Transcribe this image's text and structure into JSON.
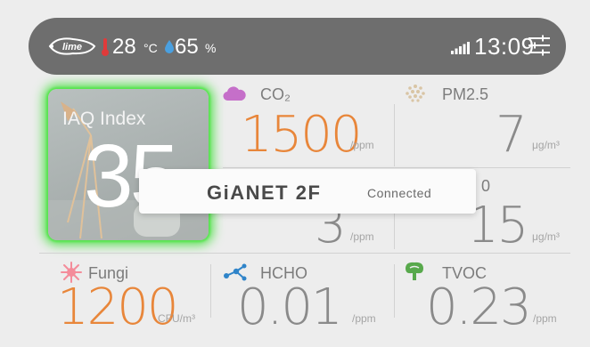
{
  "status_bar": {
    "logo_text": "lime",
    "temperature": "28",
    "temperature_unit": "°C",
    "humidity": "65",
    "humidity_unit": "%",
    "time": "13:09",
    "icons": [
      "lime-logo-icon",
      "thermometer-icon",
      "water-drop-icon",
      "signal-bars-icon",
      "settings-sliders-icon"
    ]
  },
  "iaq": {
    "label": "IAQ Index",
    "value": "35",
    "glow_color": "#53e04c"
  },
  "metrics": {
    "co2": {
      "label": "CO₂",
      "value": "1500",
      "unit": "/ppm",
      "value_color": "#e8863a",
      "icon": "cloud-icon",
      "icon_color": "#c56fc9"
    },
    "pm25": {
      "label": "PM2.5",
      "value": "7",
      "unit": "μg/m³",
      "value_color": "#8a8a8a",
      "icon": "particles-icon",
      "icon_color": "#d9c5a5"
    },
    "mid_left": {
      "value": "3",
      "unit": "/ppm",
      "value_color": "#8a8a8a"
    },
    "mid_right": {
      "label": "0",
      "value": "15",
      "unit": "μg/m³",
      "value_color": "#8a8a8a"
    },
    "fungi": {
      "label": "Fungi",
      "value": "1200",
      "unit": "CFU/m³",
      "value_color": "#e8863a",
      "icon": "spore-icon",
      "icon_color": "#f48c9a"
    },
    "hcho": {
      "label": "HCHO",
      "value": "0.01",
      "unit": "/ppm",
      "value_color": "#8a8a8a",
      "icon": "molecule-icon",
      "icon_color": "#2f84c9"
    },
    "tvoc": {
      "label": "TVOC",
      "value": "0.23",
      "unit": "/ppm",
      "value_color": "#8a8a8a",
      "icon": "leaf-tree-icon",
      "icon_color": "#58a94c"
    }
  },
  "toast": {
    "title": "GiANET 2F",
    "status": "Connected"
  },
  "colors": {
    "background": "#ededed",
    "topbar": "#6e6e6e",
    "accent_orange": "#e8863a",
    "thermometer_red": "#e03a3a",
    "humidity_blue": "#4aa0e0"
  }
}
